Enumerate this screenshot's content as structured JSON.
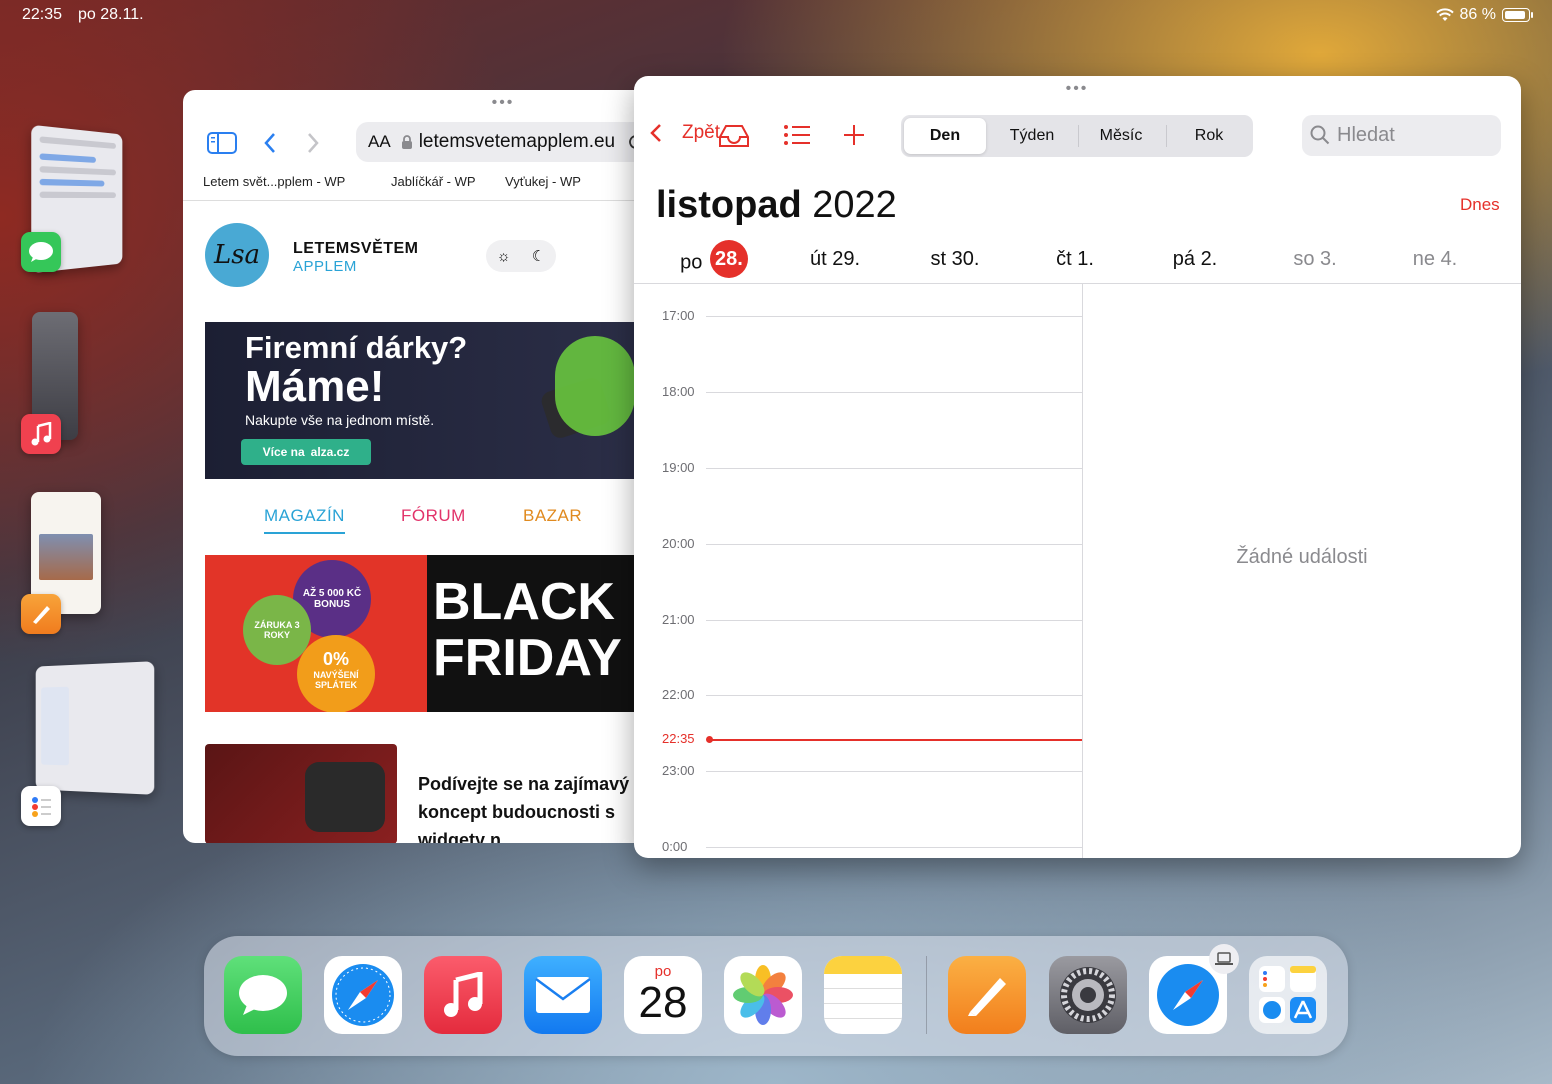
{
  "status_bar": {
    "time": "22:35",
    "date": "po 28.11.",
    "battery": "86 %",
    "battery_level": 0.86
  },
  "shelf": {
    "apps": [
      "Zprávy",
      "Hudba",
      "Pages",
      "Připomínky"
    ]
  },
  "safari": {
    "text_size_label": "AA",
    "url": "letemsvetemapplem.eu",
    "favorites": [
      "Letem svět...pplem - WP",
      "Jablíčkář - WP",
      "Vyťukej - WP"
    ],
    "site_logo_text": "Lsa",
    "site_name_line1": "LETEMSVĚTEM",
    "site_name_line2": "APPLEM",
    "banner1": {
      "heading1": "Firemní dárky?",
      "heading2": "Máme!",
      "sub": "Nakupte vše na jednom místě.",
      "cta": "Více na",
      "cta_brand": "alza.cz"
    },
    "nav": [
      "MAGAZÍN",
      "FÓRUM",
      "BAZAR"
    ],
    "banner2": {
      "bonus": "AŽ 5 000 KČ BONUS",
      "warranty": "ZÁRUKA 3 ROKY",
      "rate": "0%",
      "rate_sub": "NAVÝŠENÍ SPLÁTEK",
      "title1": "BLACK",
      "title2": "FRIDAY"
    },
    "article_title": "Podívejte se na zajímavý koncept budoucnosti s widgety n"
  },
  "calendar": {
    "back_label": "Zpět",
    "segments": [
      "Den",
      "Týden",
      "Měsíc",
      "Rok"
    ],
    "selected_segment": "Den",
    "search_placeholder": "Hledat",
    "month": "listopad",
    "year": "2022",
    "today_button": "Dnes",
    "days": [
      {
        "name": "po",
        "num": "28.",
        "today": true
      },
      {
        "name": "út",
        "num": "29."
      },
      {
        "name": "st",
        "num": "30."
      },
      {
        "name": "čt",
        "num": "1."
      },
      {
        "name": "pá",
        "num": "2."
      },
      {
        "name": "so",
        "num": "3.",
        "weekend": true
      },
      {
        "name": "ne",
        "num": "4.",
        "weekend": true
      }
    ],
    "hours": [
      "17:00",
      "18:00",
      "19:00",
      "20:00",
      "21:00",
      "22:00",
      "23:00",
      "0:00"
    ],
    "current_time": "22:35",
    "no_events": "Žádné události"
  },
  "dock": {
    "calendar_weekday": "po",
    "calendar_day": "28",
    "apps": [
      "Zprávy",
      "Safari",
      "Hudba",
      "Mail",
      "Kalendář",
      "Fotky",
      "Poznámky",
      "Pages",
      "Nastavení",
      "Safari",
      "App Library"
    ]
  },
  "colors": {
    "accent_red": "#e5302a",
    "link_blue": "#2aa3d6",
    "forum_pink": "#e2336a",
    "bazar_orange": "#e08a1f"
  }
}
